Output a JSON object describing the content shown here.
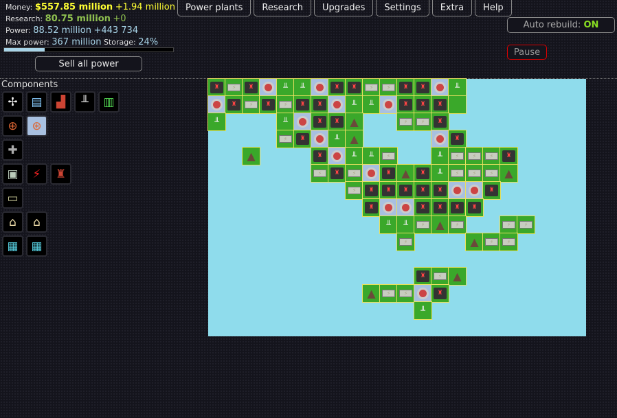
{
  "stats": {
    "money_label": "Money:",
    "money": "$557.85 million",
    "money_delta": "+1.94 million",
    "research_label": "Research:",
    "research": "80.75 million",
    "research_delta": "+0",
    "power_label": "Power:",
    "power": "88.52 million",
    "power_delta": "+443 734",
    "max_power_label": "Max power:",
    "max_power": "367 million",
    "storage_label": "Storage:",
    "storage": "24%",
    "storage_fraction": 0.24
  },
  "sell_button": "Sell all power",
  "nav": [
    "Power plants",
    "Research",
    "Upgrades",
    "Settings",
    "Extra",
    "Help"
  ],
  "auto_rebuild": {
    "label": "Auto rebuild:",
    "value": "ON",
    "color": "#88dd22"
  },
  "pause_button": "Pause",
  "components": {
    "title": "Components",
    "rows": [
      [
        "wind-turbine",
        "solar-panel",
        "coal-plant",
        "gas-plant",
        "fusion-cells"
      ],
      [
        "nuclear-reactor",
        "reactor-shielded"
      ],
      [
        "heat-exchanger"
      ],
      [
        "battery-block",
        "battery-red",
        "power-tower"
      ],
      [
        "battery-small"
      ],
      [
        "house-small",
        "house"
      ],
      [
        "office",
        "office-large"
      ]
    ]
  },
  "map": {
    "legend": {
      ".": "water",
      "t": "power-tower",
      "b": "battery",
      "R": "reactor",
      "c": "gas-plant",
      "m": "mountain"
    },
    "rows": [
      "tbtRccRttbbttRc.......",
      "RtbtbttRccRtttg.......",
      "c...cRttm..bbt........",
      "....btRcm....Rt.......",
      "..m...tRccb..cbbbt....",
      "......btbRtmtcbbbm....",
      "........btttttRRt.....",
      ".........tRRtttt......",
      "..........ccbmb..bb...",
      "...........b...mbb....",
      "......................",
      "............tbm.......",
      ".........mbbRt........",
      "............c.........",
      "......................"
    ]
  }
}
